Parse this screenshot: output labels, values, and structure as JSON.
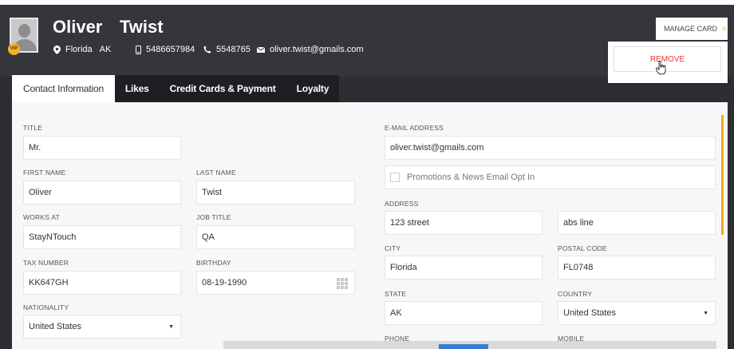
{
  "header": {
    "first_name": "Oliver",
    "last_name": "Twist",
    "vip_badge": "VIP",
    "city": "Florida",
    "state": "AK",
    "mobile": "5486657984",
    "phone": "5548765",
    "email": "oliver.twist@gmails.com"
  },
  "manage_card": {
    "label": "MANAGE CARD",
    "remove_label": "REMOVE"
  },
  "tabs": [
    {
      "label": "Contact Information",
      "active": true
    },
    {
      "label": "Likes"
    },
    {
      "label": "Credit Cards & Payment"
    },
    {
      "label": "Loyalty"
    }
  ],
  "form": {
    "title": {
      "label": "TITLE",
      "value": "Mr."
    },
    "first_name": {
      "label": "FIRST NAME",
      "value": "Oliver"
    },
    "last_name": {
      "label": "LAST NAME",
      "value": "Twist"
    },
    "works_at": {
      "label": "WORKS AT",
      "value": "StayNTouch"
    },
    "job_title": {
      "label": "JOB TITLE",
      "value": "QA"
    },
    "tax_number": {
      "label": "TAX NUMBER",
      "value": "KK647GH"
    },
    "birthday": {
      "label": "BIRTHDAY",
      "value": "08-19-1990"
    },
    "nationality": {
      "label": "NATIONALITY",
      "value": "United States"
    },
    "email": {
      "label": "E-MAIL ADDRESS",
      "value": "oliver.twist@gmails.com"
    },
    "promotions": {
      "label": "Promotions & News Email Opt In",
      "checked": false
    },
    "address": {
      "label": "ADDRESS",
      "line1": "123 street",
      "line2": "abs line"
    },
    "city": {
      "label": "CITY",
      "value": "Florida"
    },
    "postal_code": {
      "label": "POSTAL CODE",
      "value": "FL0748"
    },
    "state": {
      "label": "STATE",
      "value": "AK"
    },
    "country": {
      "label": "COUNTRY",
      "value": "United States"
    },
    "phone": {
      "label": "PHONE"
    },
    "mobile": {
      "label": "MOBILE"
    }
  },
  "colors": {
    "header_bg": "#35363b",
    "accent_orange": "#f5a623",
    "remove_red": "#e53935",
    "vip_gold": "#f0b429"
  },
  "icons": [
    "location-pin-icon",
    "mobile-phone-icon",
    "phone-icon",
    "envelope-icon",
    "chevron-up-icon",
    "calendar-icon",
    "caret-down-icon",
    "hand-cursor-icon",
    "user-avatar-icon"
  ]
}
